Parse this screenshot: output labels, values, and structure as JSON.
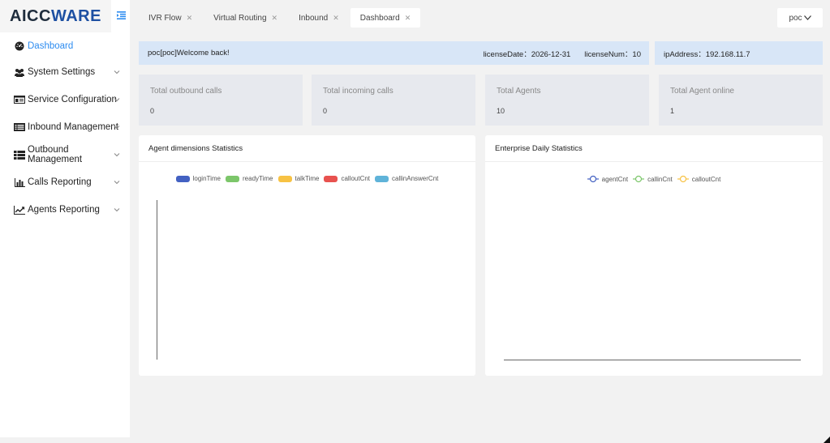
{
  "app": {
    "logo_part1": "AICC",
    "logo_part2": "WARE"
  },
  "colors": {
    "accent": "#2d8cf0",
    "info_bg": "#d8e6f7",
    "card_bg": "#e7e9ee"
  },
  "sidebar": {
    "items": [
      {
        "label": "Dashboard",
        "icon": "dashboard-icon"
      },
      {
        "label": "System Settings",
        "icon": "users-icon"
      },
      {
        "label": "Service Configuration",
        "icon": "id-card-icon"
      },
      {
        "label": "Inbound Management",
        "icon": "list-icon"
      },
      {
        "label": "Outbound Management",
        "icon": "list-bullets-icon"
      },
      {
        "label": "Calls Reporting",
        "icon": "bar-chart-icon"
      },
      {
        "label": "Agents Reporting",
        "icon": "line-chart-icon"
      }
    ]
  },
  "tabs": [
    {
      "label": "IVR Flow"
    },
    {
      "label": "Virtual Routing"
    },
    {
      "label": "Inbound"
    },
    {
      "label": "Dashboard",
      "active": true
    }
  ],
  "user": {
    "name": "poc"
  },
  "info": {
    "welcome": "poc[poc]Welcome back!",
    "license_date": "licenseDate：2026-12-31",
    "license_num": "licenseNum：10",
    "ip_address": "ipAddress：192.168.11.7"
  },
  "stats": [
    {
      "label": "Total outbound calls",
      "value": "0"
    },
    {
      "label": "Total incoming calls",
      "value": "0"
    },
    {
      "label": "Total Agents",
      "value": "10"
    },
    {
      "label": "Total Agent online",
      "value": "1"
    }
  ],
  "agent_panel": {
    "title": "Agent dimensions Statistics",
    "legend": [
      {
        "name": "loginTime",
        "color": "#4361c2"
      },
      {
        "name": "readyTime",
        "color": "#7cc66a"
      },
      {
        "name": "talkTime",
        "color": "#f7c244"
      },
      {
        "name": "calloutCnt",
        "color": "#e8524f"
      },
      {
        "name": "callinAnswerCnt",
        "color": "#5fb3d9"
      }
    ]
  },
  "enterprise_panel": {
    "title": "Enterprise Daily Statistics",
    "legend": [
      {
        "name": "agentCnt",
        "color": "#4361c2"
      },
      {
        "name": "callinCnt",
        "color": "#7cc66a"
      },
      {
        "name": "calloutCnt",
        "color": "#f7c244"
      }
    ]
  },
  "chart_data": [
    {
      "type": "bar",
      "title": "Agent dimensions Statistics",
      "categories": [],
      "series": [
        {
          "name": "loginTime",
          "values": []
        },
        {
          "name": "readyTime",
          "values": []
        },
        {
          "name": "talkTime",
          "values": []
        },
        {
          "name": "calloutCnt",
          "values": []
        },
        {
          "name": "callinAnswerCnt",
          "values": []
        }
      ],
      "legend": "top-center"
    },
    {
      "type": "line",
      "title": "Enterprise Daily Statistics",
      "x": [],
      "series": [
        {
          "name": "agentCnt",
          "values": []
        },
        {
          "name": "callinCnt",
          "values": []
        },
        {
          "name": "calloutCnt",
          "values": []
        }
      ],
      "legend": "top-center"
    }
  ]
}
